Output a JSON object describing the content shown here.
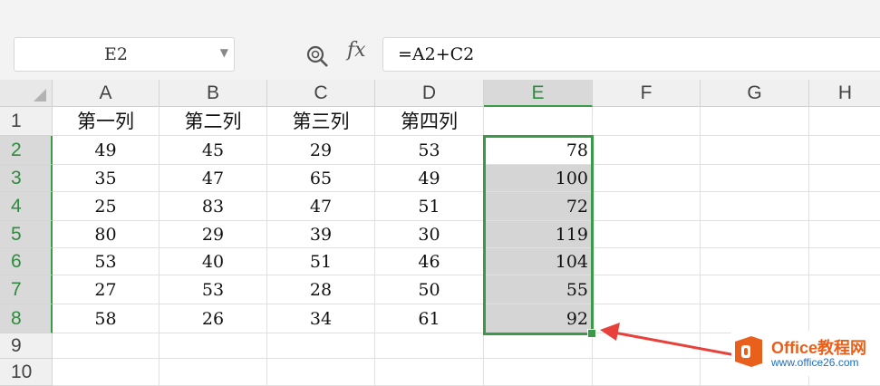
{
  "formula_bar": {
    "name_box": "E2",
    "fx_label": "fx",
    "formula": "=A2+C2"
  },
  "columns": [
    "A",
    "B",
    "C",
    "D",
    "E",
    "F",
    "G",
    "H"
  ],
  "selected_column": "E",
  "rows": [
    "1",
    "2",
    "3",
    "4",
    "5",
    "6",
    "7",
    "8",
    "9",
    "10"
  ],
  "header_row": [
    "第一列",
    "第二列",
    "第三列",
    "第四列",
    ""
  ],
  "data_rows": [
    [
      "49",
      "45",
      "29",
      "53",
      "78"
    ],
    [
      "35",
      "47",
      "65",
      "49",
      "100"
    ],
    [
      "25",
      "83",
      "47",
      "51",
      "72"
    ],
    [
      "80",
      "29",
      "39",
      "30",
      "119"
    ],
    [
      "53",
      "40",
      "51",
      "46",
      "104"
    ],
    [
      "27",
      "53",
      "28",
      "50",
      "55"
    ],
    [
      "58",
      "26",
      "34",
      "61",
      "92"
    ]
  ],
  "colors": {
    "selection": "#3a9a48",
    "arrow": "#e8403a",
    "logo_orange": "#e8601c",
    "logo_blue": "#1e6fc1"
  },
  "watermark": {
    "title": "Office教程网",
    "url": "www.office26.com"
  }
}
